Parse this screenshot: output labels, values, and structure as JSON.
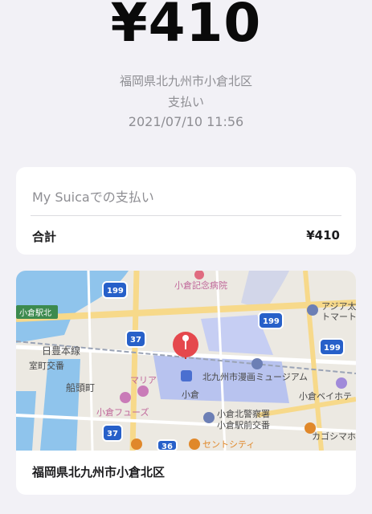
{
  "receipt": {
    "amount": "¥410",
    "location": "福岡県北九州市小倉北区",
    "type": "支払い",
    "datetime": "2021/07/10 11:56"
  },
  "summary": {
    "title": "My Suicaでの支払い",
    "total_label": "合計",
    "total_value": "¥410"
  },
  "map": {
    "caption": "福岡県北九州市小倉北区",
    "labels": {
      "hospital": "小倉記念病院",
      "kokura_north": "小倉駅北",
      "asia": "アジア太",
      "asia2": "トマート",
      "nippo": "日豊本線",
      "muromachi": "室町交番",
      "funato": "船頭町",
      "maria": "マリア",
      "manga": "北九州市漫画ミュージアム",
      "kokura": "小倉",
      "foods": "小倉フューズ",
      "police": "小倉北警察署",
      "station_police": "小倉駅前交番",
      "bay": "小倉ベイホテ",
      "city": "セントシティ",
      "kagoshima": "カゴシマホ"
    },
    "routes": {
      "r199": "199",
      "r37": "37",
      "r36": "36"
    },
    "colors": {
      "pin": "#e5484d",
      "water": "#8fc4ec",
      "station": "#b8c3ef",
      "route_shield": "#2760c9"
    }
  }
}
